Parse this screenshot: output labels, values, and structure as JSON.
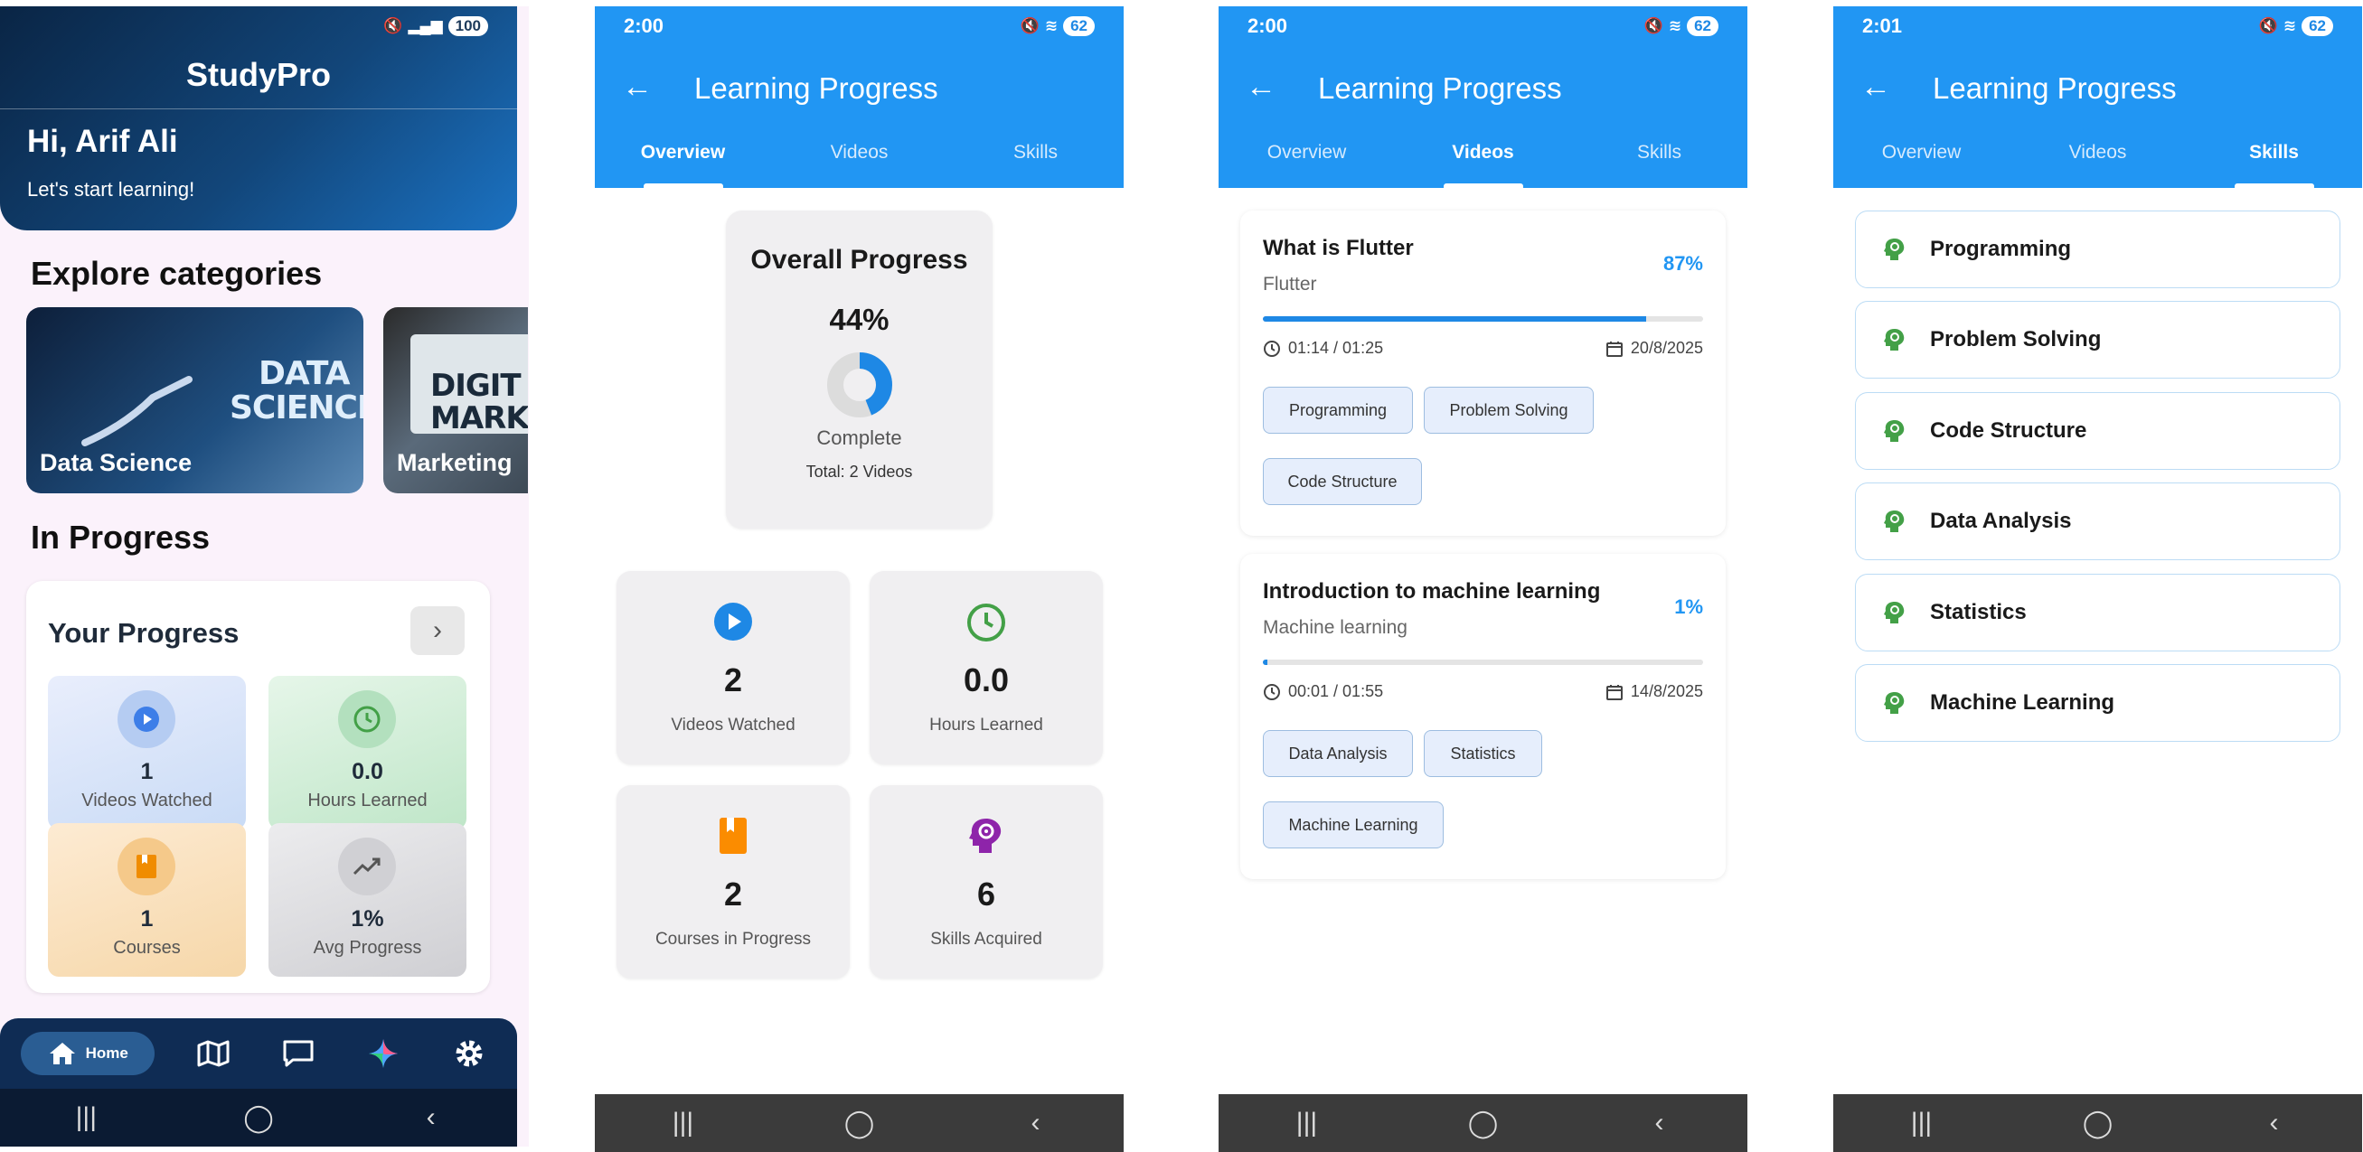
{
  "screen1": {
    "status": {
      "battery": "100"
    },
    "app_title": "StudyPro",
    "greeting": "Hi, Arif Ali",
    "subtitle": "Let's start learning!",
    "explore_title": "Explore categories",
    "categories": [
      {
        "label": "Data Science",
        "image_text": "DATA SCIENCE"
      },
      {
        "label": "Marketing",
        "image_text": "DIGIT MARKE"
      }
    ],
    "in_progress_title": "In Progress",
    "progress_card": {
      "title": "Your Progress",
      "tiles": [
        {
          "value": "1",
          "label": "Videos Watched",
          "icon": "play-icon",
          "color": "#dde6f7"
        },
        {
          "value": "0.0",
          "label": "Hours Learned",
          "icon": "clock-icon",
          "color": "#d9f0de"
        },
        {
          "value": "1",
          "label": "Courses",
          "icon": "book-icon",
          "color": "#f9e3c6"
        },
        {
          "value": "1%",
          "label": "Avg Progress",
          "icon": "trending-up-icon",
          "color": "#e0e0e2"
        }
      ]
    },
    "nav": {
      "home_label": "Home"
    }
  },
  "screen2": {
    "status": {
      "time": "2:00",
      "battery": "62"
    },
    "title": "Learning Progress",
    "tabs": [
      "Overview",
      "Videos",
      "Skills"
    ],
    "overall": {
      "title": "Overall Progress",
      "percent": "44%",
      "percent_value": 44,
      "complete_label": "Complete",
      "total": "Total: 2 Videos"
    },
    "stats": [
      {
        "value": "2",
        "label": "Videos Watched",
        "icon": "play-icon",
        "color": "#1e88e5"
      },
      {
        "value": "0.0",
        "label": "Hours Learned",
        "icon": "clock-icon",
        "color": "#43a047"
      },
      {
        "value": "2",
        "label": "Courses in Progress",
        "icon": "book-icon",
        "color": "#fb8c00"
      },
      {
        "value": "6",
        "label": "Skills Acquired",
        "icon": "brain-gear-icon",
        "color": "#8e24aa"
      }
    ]
  },
  "screen3": {
    "status": {
      "time": "2:00",
      "battery": "62"
    },
    "title": "Learning Progress",
    "tabs": [
      "Overview",
      "Videos",
      "Skills"
    ],
    "videos": [
      {
        "title": "What is Flutter",
        "course": "Flutter",
        "percent": "87%",
        "progress": 0.87,
        "time": "01:14 / 01:25",
        "date": "20/8/2025",
        "skills": [
          "Programming",
          "Problem Solving",
          "Code Structure"
        ]
      },
      {
        "title": "Introduction to machine learning",
        "course": "Machine learning",
        "percent": "1%",
        "progress": 0.01,
        "time": "00:01 / 01:55",
        "date": "14/8/2025",
        "skills": [
          "Data Analysis",
          "Statistics",
          "Machine Learning"
        ]
      }
    ]
  },
  "screen4": {
    "status": {
      "time": "2:01",
      "battery": "62"
    },
    "title": "Learning Progress",
    "tabs": [
      "Overview",
      "Videos",
      "Skills"
    ],
    "skills": [
      "Programming",
      "Problem Solving",
      "Code Structure",
      "Data Analysis",
      "Statistics",
      "Machine Learning"
    ]
  }
}
